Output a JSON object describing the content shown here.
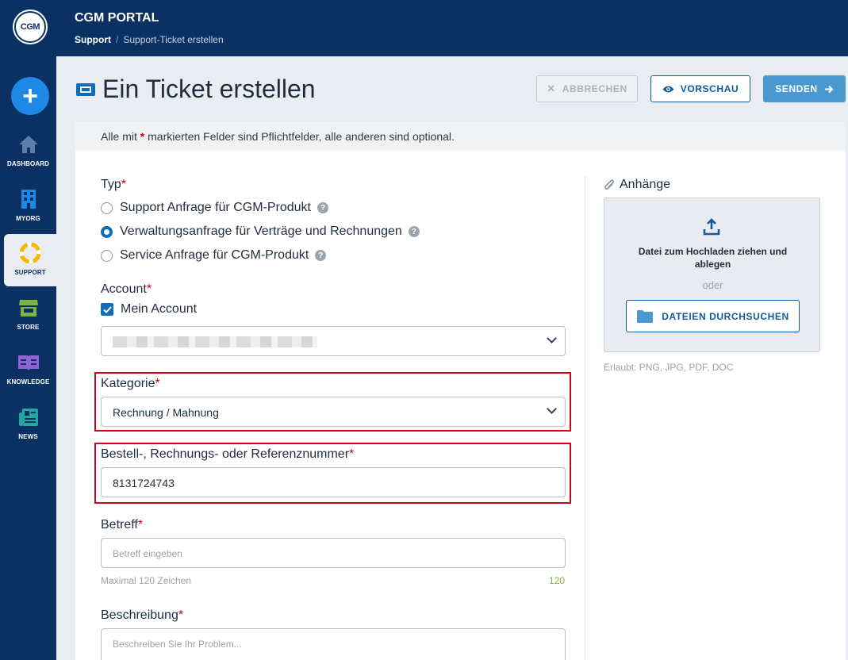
{
  "app": {
    "logo_text": "CGM",
    "portal_title": "CGM PORTAL",
    "breadcrumb": {
      "root": "Support",
      "separator": "/",
      "current": "Support-Ticket erstellen"
    }
  },
  "sidebar": {
    "new_button": "+",
    "items": [
      {
        "label": "DASHBOARD",
        "icon": "home-icon",
        "color": "#5b7fa8"
      },
      {
        "label": "MYORG",
        "icon": "building-icon",
        "color": "#1e88e5"
      },
      {
        "label": "SUPPORT",
        "icon": "lifebuoy-icon",
        "color": "#f5b800",
        "active": true
      },
      {
        "label": "STORE",
        "icon": "store-icon",
        "color": "#7cb342"
      },
      {
        "label": "KNOWLEDGE",
        "icon": "book-icon",
        "color": "#8e63d6"
      },
      {
        "label": "NEWS",
        "icon": "newspaper-icon",
        "color": "#26a5a5"
      }
    ]
  },
  "page": {
    "title": "Ein Ticket erstellen",
    "buttons": {
      "cancel": "ABBRECHEN",
      "preview": "VORSCHAU",
      "send": "SENDEN"
    }
  },
  "form": {
    "notice_prefix": "Alle mit ",
    "notice_star": "*",
    "notice_suffix": " markierten Felder sind Pflichtfelder, alle anderen sind optional.",
    "type": {
      "label": "Typ",
      "required_mark": "*",
      "options": [
        {
          "label": "Support Anfrage für CGM-Produkt",
          "checked": false
        },
        {
          "label": "Verwaltungsanfrage für Verträge und Rechnungen",
          "checked": true
        },
        {
          "label": "Service Anfrage für CGM-Produkt",
          "checked": false
        }
      ]
    },
    "account": {
      "label": "Account",
      "required_mark": "*",
      "checkbox_label": "Mein Account",
      "checkbox_checked": true
    },
    "category": {
      "label": "Kategorie",
      "required_mark": "*",
      "value": "Rechnung / Mahnung"
    },
    "reference": {
      "label": "Bestell-, Rechnungs- oder Referenznummer",
      "required_mark": "*",
      "value": "8131724743"
    },
    "subject": {
      "label": "Betreff",
      "required_mark": "*",
      "placeholder": "Betreff eingeben",
      "hint": "Maximal 120 Zeichen",
      "counter": "120"
    },
    "description": {
      "label": "Beschreibung",
      "required_mark": "*",
      "placeholder": "Beschreiben Sie Ihr Problem..."
    }
  },
  "attachments": {
    "label": "Anhänge",
    "drop_text": "Datei zum Hochladen ziehen und ablegen",
    "or_text": "oder",
    "browse_button": "DATEIEN DURCHSUCHEN",
    "allowed": "Erlaubt: PNG, JPG, PDF, DOC"
  },
  "colors": {
    "brand": "#0b3162",
    "accent": "#0f6cbd",
    "required": "#d0021b",
    "highlight_border": "#d0021b"
  }
}
